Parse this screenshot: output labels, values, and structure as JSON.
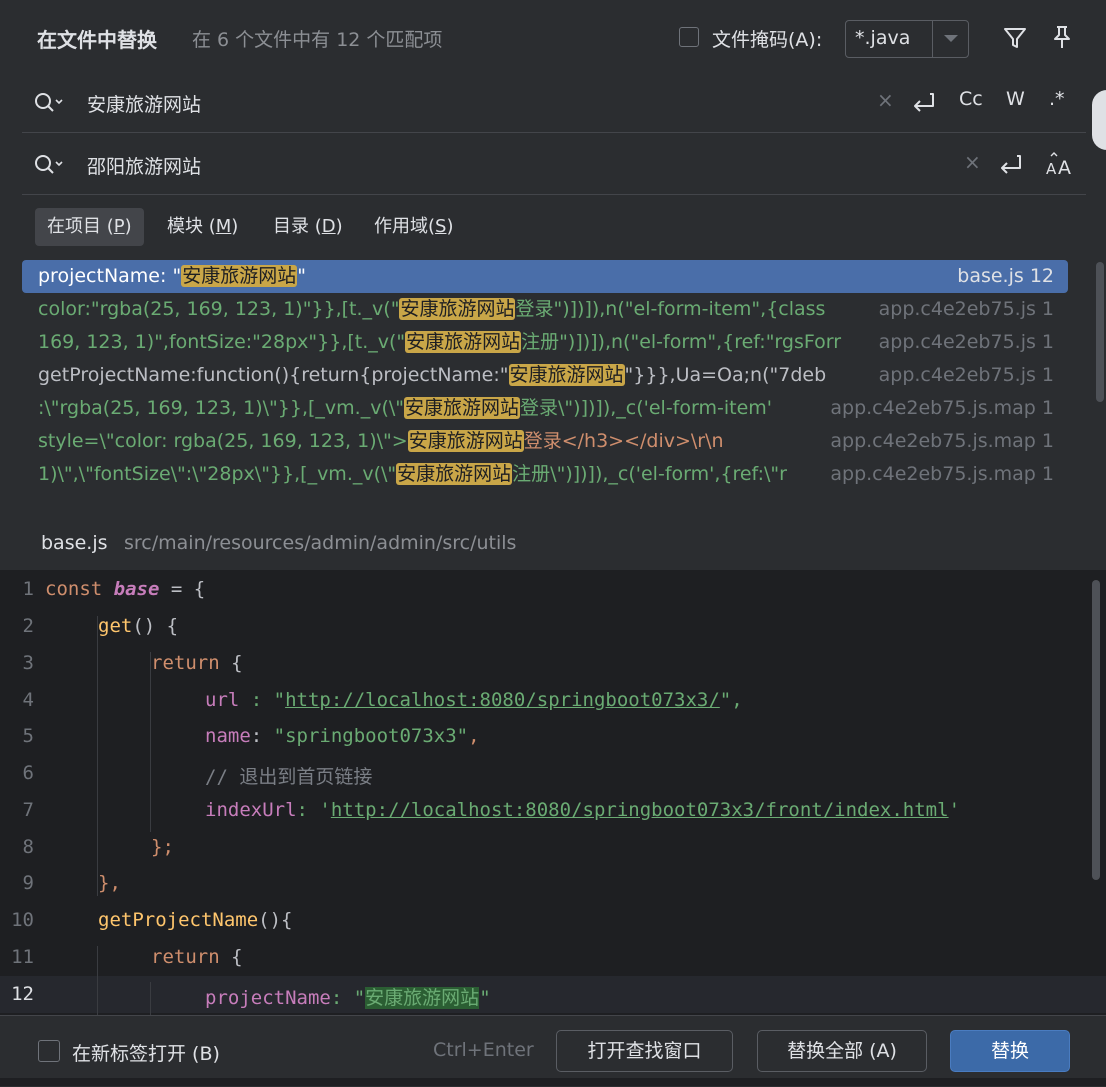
{
  "header": {
    "title": "在文件中替换",
    "match_info": "在 6 个文件中有 12 个匹配项",
    "file_mask_label": "文件掩码(A):",
    "file_mask_value": "*.java"
  },
  "find": {
    "value": "安康旅游网站",
    "buttons": [
      "Cc",
      "W",
      ".*"
    ]
  },
  "replace": {
    "value": "邵阳旅游网站"
  },
  "scopes": [
    {
      "label": "在项目 (",
      "key": "P",
      "tail": ")"
    },
    {
      "label": "模块 (",
      "key": "M",
      "tail": ")"
    },
    {
      "label": "目录 (",
      "key": "D",
      "tail": ")"
    },
    {
      "label": "作用域(",
      "key": "S",
      "tail": ")"
    }
  ],
  "results": [
    {
      "pre": "projectName: \"",
      "match": "安康旅游网站",
      "post": "\"",
      "file": "base.js 12"
    },
    {
      "pre": "color:\"rgba(25, 169, 123, 1)\"}},[t._v(\"",
      "match": "安康旅游网站",
      "post": "登录\")])]),n(\"el-form-item\",{class",
      "file": "app.c4e2eb75.js 1"
    },
    {
      "pre": "169, 123, 1)\",fontSize:\"28px\"}},[t._v(\"",
      "match": "安康旅游网站",
      "post": "注册\")])]),n(\"el-form\",{ref:\"rgsForr",
      "file": "app.c4e2eb75.js 1"
    },
    {
      "pre": "getProjectName:function(){return{projectName:\"",
      "match": "安康旅游网站",
      "post": "\"}}},Ua=Oa;n(\"7deb",
      "file": "app.c4e2eb75.js 1"
    },
    {
      "pre": ":\\\"rgba(25, 169, 123, 1)\\\"}},[_vm._v(\\\"",
      "match": "安康旅游网站",
      "post": "登录\\\")])]),_c('el-form-item'",
      "file": "app.c4e2eb75.js.map 1"
    },
    {
      "pre": "style=\\\"color: rgba(25, 169, 123, 1)\\\">",
      "match": "安康旅游网站",
      "post": "登录</h3></div>\\r\\n",
      "file": "app.c4e2eb75.js.map 1"
    },
    {
      "pre": "1)\\\",\\\"fontSize\\\":\\\"28px\\\"}},[_vm._v(\\\"",
      "match": "安康旅游网站",
      "post": "注册\\\")])]),_c('el-form',{ref:\\\"r",
      "file": "app.c4e2eb75.js.map 1"
    }
  ],
  "preview": {
    "file_name": "base.js",
    "file_path": "src/main/resources/admin/admin/src/utils",
    "lines": [
      "1",
      "2",
      "3",
      "4",
      "5",
      "6",
      "7",
      "8",
      "9",
      "10",
      "11",
      "12"
    ],
    "current_line": "12",
    "code": {
      "l1_kw": "const",
      "l1_var": "base",
      "l1_rest": " = {",
      "l2_fn": "get",
      "l2_rest": "() {",
      "l3_kw": "return",
      "l3_rest": " {",
      "l4_prop": "url",
      "l4_sep": " : \"",
      "l4_url": "http://localhost:8080/springboot073x3/",
      "l4_end": "\",",
      "l5_prop": "name",
      "l5_sep": ": ",
      "l5_str": "\"springboot073x3\"",
      "l5_end": ",",
      "l6_cmt": "// 退出到首页链接",
      "l7_prop": "indexUrl",
      "l7_sep": ": '",
      "l7_url": "http://localhost:8080/springboot073x3/front/index.html",
      "l7_end": "'",
      "l8": "};",
      "l9": "},",
      "l10_fn": "getProjectName",
      "l10_rest": "(){",
      "l11_kw": "return",
      "l11_rest": " {",
      "l12_prop": "projectName",
      "l12_sep": ": \"",
      "l12_match": "安康旅游网站",
      "l12_end": "\""
    }
  },
  "footer": {
    "new_tab_label": "在新标签打开 (B)",
    "shortcut": "Ctrl+Enter",
    "open_find_window": "打开查找窗口",
    "replace_all": "替换全部 (A)",
    "replace": "替换"
  },
  "colors": {
    "highlight": "#c9a648",
    "selected_row": "#4a6ea9",
    "primary_button": "#3c6aa8"
  }
}
